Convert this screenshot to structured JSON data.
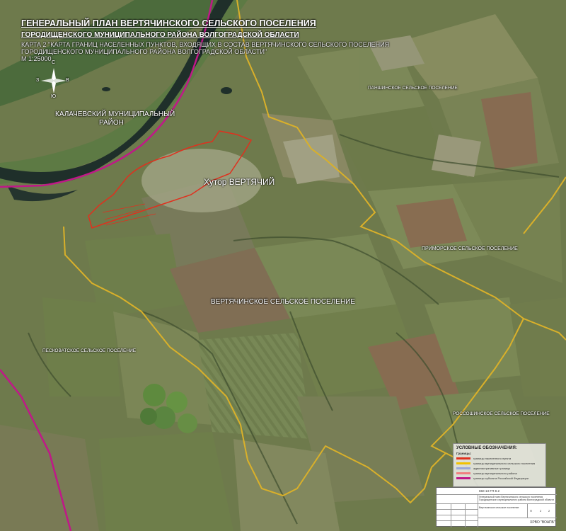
{
  "header": {
    "title": "ГЕНЕРАЛЬНЫЙ ПЛАН ВЕРТЯЧИНСКОГО СЕЛЬСКОГО ПОСЕЛЕНИЯ",
    "subtitle": "ГОРОДИЩЕНСКОГО МУНИЦИПАЛЬНОГО РАЙОНА ВОЛГОГРАДСКОЙ ОБЛАСТИ",
    "caption_line1": "КАРТА 2 \"КАРТА ГРАНИЦ НАСЕЛЕННЫХ ПУНКТОВ, ВХОДЯЩИХ В СОСТАВ ВЕРТЯЧИНСКОГО СЕЛЬСКОГО ПОСЕЛЕНИЯ",
    "caption_line2": "ГОРОДИЩЕНСКОГО МУНИЦИПАЛЬНОГО РАЙОНА ВОЛГОГРАДСКОЙ ОБЛАСТИ\"",
    "scale": "М 1:25000"
  },
  "compass": {
    "n": "С",
    "s": "Ю",
    "w": "З",
    "e": "В"
  },
  "labels": {
    "kalach_line1": "КАЛАЧЕВСКИЙ МУНИЦИПАЛЬНЫЙ",
    "kalach_line2": "РАЙОН",
    "panshino": "ПАНШИНСКОЕ СЕЛЬСКОЕ ПОСЕЛЕНИЕ",
    "village": "Хутор ВЕРТЯЧИЙ",
    "primorskoe": "ПРИМОРСКОЕ СЕЛЬСКОЕ ПОСЕЛЕНИЕ",
    "vertyachinskoe": "ВЕРТЯЧИНСКОЕ СЕЛЬСКОЕ ПОСЕЛЕНИЕ",
    "peskovatskoe": "ПЕСКОВАТСКОЕ СЕЛЬСКОЕ ПОСЕЛЕНИЕ",
    "rossoshinskoe": "РОССОШИНСКОЕ СЕЛЬСКОЕ ПОСЕЛЕНИЕ"
  },
  "legend": {
    "title": "УСЛОВНЫЕ ОБОЗНАЧЕНИЯ:",
    "section": "Границы:",
    "items": [
      {
        "color": "#e0301e",
        "text": "границы населенного пункта"
      },
      {
        "color": "#f2c200",
        "text": "границы муниципального сельского поселения"
      },
      {
        "color": "#9aa8d8",
        "text": "административные границы"
      },
      {
        "color": "#f08080",
        "text": "границы муниципального района"
      },
      {
        "color": "#c01888",
        "text": "границы субъекта Российской Федерации"
      }
    ]
  },
  "stamp": {
    "code": "650-13-ГП-К.2",
    "descr": "Генеральный план Вертячинского сельского поселения Городищенского муниципального района Волгоградской области",
    "sheet_title": "Вертячинское сельское поселение",
    "stage": "П",
    "sheet": "2",
    "sheets": "2",
    "org": "ХРВО \"ВОАПБ\""
  },
  "colors": {
    "settlement_boundary": "#e0301e",
    "municipal_boundary": "#d9b02a",
    "region_boundary": "#c01888",
    "river": "#1f2f2a"
  }
}
